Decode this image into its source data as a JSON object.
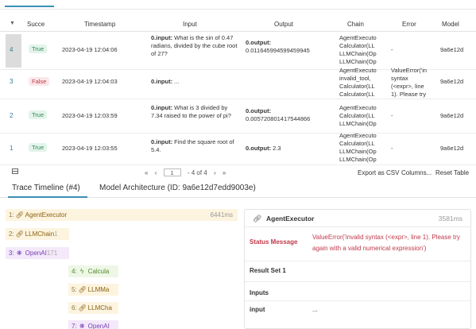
{
  "table": {
    "columns": {
      "success": "Succe",
      "timestamp": "Timestamp",
      "input": "Input",
      "output": "Output",
      "chain": "Chain",
      "error": "Error",
      "model": "Model"
    },
    "rows": [
      {
        "index": "4",
        "success": "True",
        "timestamp": "2023-04-19 12:04:06",
        "input_key": "0.input:",
        "input_text": " What is the sin of 0.47 radians, divided by the cube root of 27?",
        "output_key": "0.output:",
        "output_text": "0.011645994599459945",
        "chain": [
          "AgentExecuto",
          "Calculator(LL",
          "LLMChain(Op",
          "LLMChain(Op"
        ],
        "error": "-",
        "model": "9a6e12d"
      },
      {
        "index": "3",
        "success": "False",
        "timestamp": "2023-04-19 12:04:03",
        "input_key": "0.input:",
        "input_text": " ...",
        "output_key": "",
        "output_text": "",
        "chain": [
          "AgentExecuto",
          "invalid_tool,",
          "Calculator(LL",
          "Calculator(LL"
        ],
        "error": [
          "ValueError('in",
          "syntax",
          "(<expr>, line",
          "1). Please try"
        ],
        "model": "9a6e12d"
      },
      {
        "index": "2",
        "success": "True",
        "timestamp": "2023-04-19 12:03:59",
        "input_key": "0.input:",
        "input_text": " What is 3 divided by 7.34 raised to the power of pi?",
        "output_key": "0.output:",
        "output_text": "0.005720801417544866",
        "chain": [
          "AgentExecuto",
          "Calculator(LL",
          "LLMChain(Op"
        ],
        "error": "-",
        "model": "9a6e12d"
      },
      {
        "index": "1",
        "success": "True",
        "timestamp": "2023-04-19 12:03:55",
        "input_key": "0.input:",
        "input_text": " Find the square root of 5.4.",
        "output_key": "0.output:",
        "output_text": " 2.3",
        "chain": [
          "AgentExecuto",
          "Calculator(LL",
          "LLMChain(Op",
          "LLMChain(Op"
        ],
        "error": "-",
        "model": "9a6e12d"
      }
    ]
  },
  "pager": {
    "first": "«",
    "prev": "‹",
    "page": "1",
    "of": "- 4 of 4",
    "next": "›",
    "last": "»"
  },
  "table_actions": {
    "export": "Export as CSV",
    "columns": "Columns...",
    "reset": "Reset Table"
  },
  "tabs": {
    "timeline": "Trace Timeline (#4)",
    "architecture": "Model Architecture (ID: 9a6e12d7edd9003e)"
  },
  "timeline": [
    {
      "num": "1:",
      "label": "AgentExecutor",
      "duration": "6441ms",
      "kind": "agent",
      "icon": "link-icon"
    },
    {
      "num": "2:",
      "label": "LLMChain",
      "suffix": "1",
      "kind": "llm",
      "icon": "link-icon"
    },
    {
      "num": "3:",
      "label": "OpenAI",
      "suffix": "171",
      "kind": "openai",
      "icon": "openai-icon"
    },
    {
      "num": "4:",
      "label": "Calcula",
      "kind": "tool",
      "icon": "lightning-icon"
    },
    {
      "num": "5:",
      "label": "LLMMa",
      "kind": "llm",
      "icon": "link-icon"
    },
    {
      "num": "6:",
      "label": "LLMCha",
      "kind": "llm",
      "icon": "link-icon"
    },
    {
      "num": "7:",
      "label": "OpenAI",
      "kind": "openai",
      "icon": "openai-icon"
    }
  ],
  "detail": {
    "title": "AgentExecutor",
    "duration": "3581ms",
    "status_label": "Status Message",
    "status_value": "ValueError('invalid syntax (<expr>, line 1). Please try again with a valid numerical expression')",
    "result_set": "Result Set 1",
    "inputs_label": "Inputs",
    "input_key": "input",
    "input_value": "..."
  },
  "colors": {
    "accent": "#3a8fb7",
    "success": "#2e8b57",
    "error": "#c0394b",
    "chain": "#8a6212",
    "openai": "#7a3fb0",
    "tool": "#4d8b2c"
  }
}
